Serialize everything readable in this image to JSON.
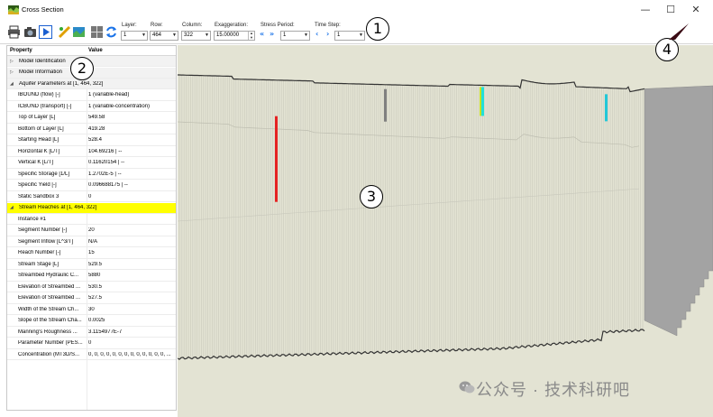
{
  "window": {
    "title": "Cross Section",
    "minimize_glyph": "—",
    "maximize_glyph": "☐",
    "close_glyph": "✕"
  },
  "toolbar": {
    "icons": [
      "print-icon",
      "camera-icon",
      "play-icon",
      "ruler-icon",
      "map-icon",
      "grid-icon",
      "refresh-icon"
    ],
    "layer_label": "Layer:",
    "layer_value": "1",
    "row_label": "Row:",
    "row_value": "464",
    "column_label": "Column:",
    "column_value": "322",
    "exaggeration_label": "Exaggeration:",
    "exaggeration_value": "15.00000",
    "stress_period_label": "Stress Period:",
    "stress_period_value": "1",
    "time_step_label": "Time Step:",
    "time_step_value": "1",
    "first_glyph": "«",
    "last_glyph": "»",
    "prev_glyph": "‹",
    "next_glyph": "›"
  },
  "callouts": [
    "1",
    "2",
    "3",
    "4"
  ],
  "properties": {
    "header_property": "Property",
    "header_value": "Value",
    "rows": [
      {
        "type": "cat",
        "key": "Model Identification",
        "value": "",
        "tri": "▷"
      },
      {
        "type": "cat",
        "key": "Model Information",
        "value": "",
        "tri": "▷"
      },
      {
        "type": "cat",
        "key": "Aquifer Parameters at [1, 464, 322]",
        "value": "",
        "tri": "◢"
      },
      {
        "type": "row",
        "key": "IBOUND (flow) [-]",
        "value": "1 (variable-head)"
      },
      {
        "type": "row",
        "key": "ICBUND (transport) [-]",
        "value": "1 (variable-concentration)"
      },
      {
        "type": "row",
        "key": "Top of Layer [L]",
        "value": "549.58"
      },
      {
        "type": "row",
        "key": "Bottom of Layer [L]",
        "value": "419.28"
      },
      {
        "type": "row",
        "key": "Starting Head [L]",
        "value": "528.4"
      },
      {
        "type": "row",
        "key": "Horizontal K [L/T]",
        "value": "104.69216 | --"
      },
      {
        "type": "row",
        "key": "Vertical K [L/T]",
        "value": "0.11620154 | --"
      },
      {
        "type": "row",
        "key": "Specific Storage [1/L]",
        "value": "1.2702E-5 | --"
      },
      {
        "type": "row",
        "key": "Specific Yield [-]",
        "value": "0.096688175 | --"
      },
      {
        "type": "row",
        "key": "Static Sandbox 3",
        "value": "0"
      },
      {
        "type": "hl",
        "key": "Stream Reaches at [1, 464, 322]",
        "value": "",
        "tri": "◢"
      },
      {
        "type": "row",
        "key": "Instance #1",
        "value": ""
      },
      {
        "type": "row",
        "key": "Segment Number [-]",
        "value": "20"
      },
      {
        "type": "row",
        "key": "Segment Inflow [L^3/T]",
        "value": "N/A"
      },
      {
        "type": "row",
        "key": "Reach Number [-]",
        "value": "15"
      },
      {
        "type": "row",
        "key": "Stream Stage [L]",
        "value": "529.5"
      },
      {
        "type": "row",
        "key": "Streambed Hydraulic C...",
        "value": "5880"
      },
      {
        "type": "row",
        "key": "Elevation of Streambed ...",
        "value": "530.5"
      },
      {
        "type": "row",
        "key": "Elevation of Streambed ...",
        "value": "527.5"
      },
      {
        "type": "row",
        "key": "Width of the Stream Ch...",
        "value": "30"
      },
      {
        "type": "row",
        "key": "Slope of the Stream Cha...",
        "value": "0.0025"
      },
      {
        "type": "row",
        "key": "Manning's Roughness ...",
        "value": "3.1154977E-7"
      },
      {
        "type": "row",
        "key": "Parameter Number (PES...",
        "value": "0"
      },
      {
        "type": "row",
        "key": "Concentration (MT3D/S...",
        "value": "0, 0, 0, 0, 0, 0, 0, 0, 0, 0, 0, 0, 0, ..."
      }
    ]
  },
  "viewport": {
    "background_color": "#e3e3d3",
    "cell_line_color": "#cfcfc0",
    "inactive_color": "#a3a3a3",
    "marker_colors": [
      "#e52222",
      "#808080",
      "#1fe0d8",
      "#c8e020",
      "#22c8d8"
    ]
  },
  "watermark": "公众号 · 技术科研吧"
}
